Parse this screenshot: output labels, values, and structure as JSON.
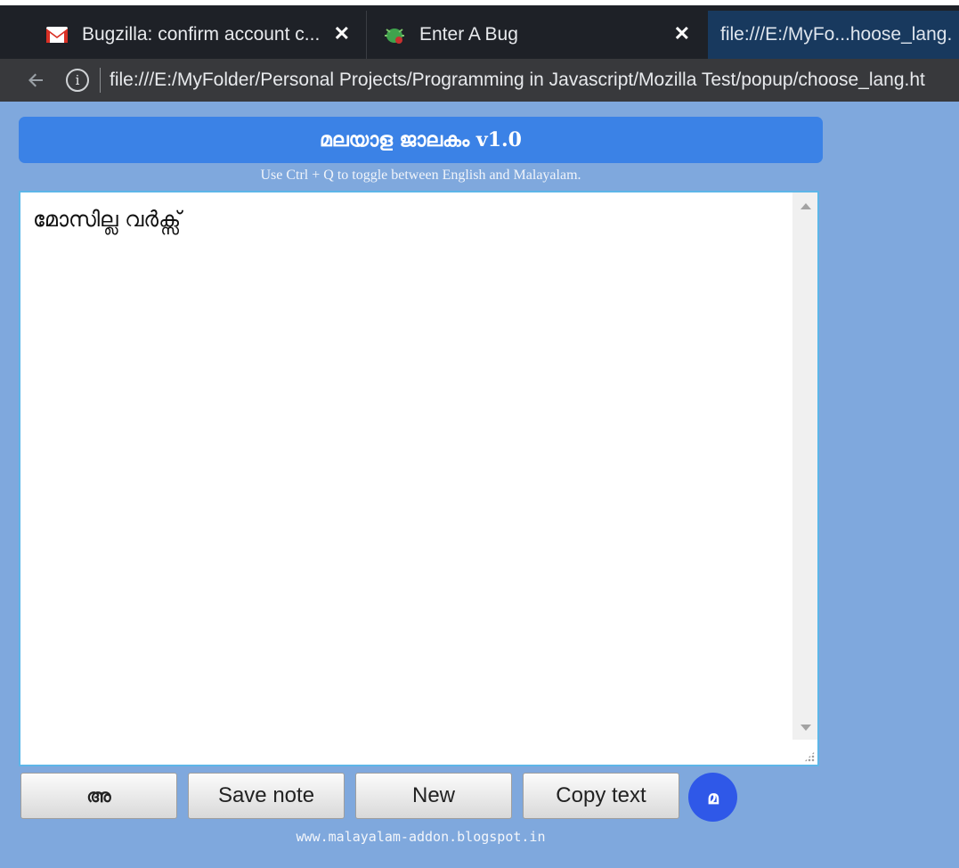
{
  "browser": {
    "tabs": [
      {
        "title": "Bugzilla: confirm account c...",
        "icon": "gmail-icon",
        "active": false
      },
      {
        "title": "Enter A Bug",
        "icon": "bugzilla-icon",
        "active": false
      },
      {
        "title": "file:///E:/MyFo...hoose_lang.",
        "icon": "",
        "active": true
      }
    ],
    "close_glyph": "✕",
    "address": "file:///E:/MyFolder/Personal Projects/Programming in Javascript/Mozilla Test/popup/choose_lang.ht"
  },
  "popup": {
    "title": "മലയാള ജാലകം v1.0",
    "hint": "Use Ctrl + Q to toggle between English and Malayalam.",
    "editor_text": "മോസില്ല വർക്സ്",
    "buttons": {
      "lang": "അ",
      "save": "Save note",
      "new": "New",
      "copy": "Copy text",
      "round": "മ"
    },
    "footer": "www.malayalam-addon.blogspot.in"
  },
  "colors": {
    "page_bg": "#7fa8dd",
    "header_bg": "#3b82e6",
    "round_button": "#2f58e8",
    "editor_border": "#5db6e8"
  }
}
